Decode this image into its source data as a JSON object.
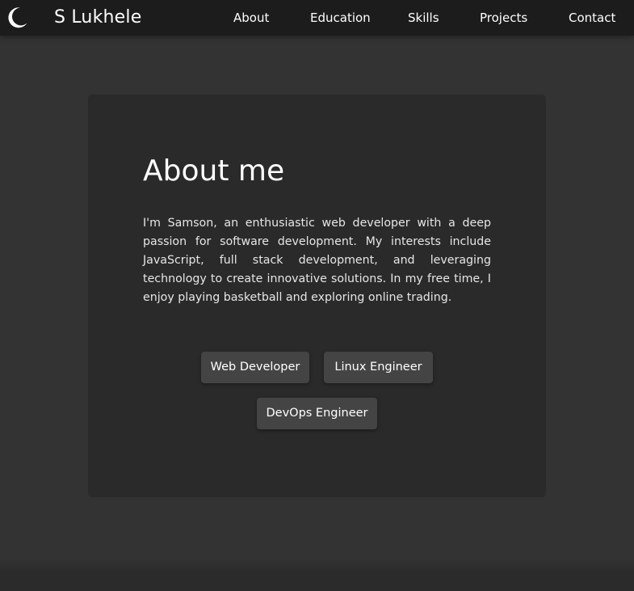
{
  "header": {
    "logo_icon": "crescent-moon-icon",
    "brand": "S Lukhele",
    "nav": [
      {
        "label": "About"
      },
      {
        "label": "Education"
      },
      {
        "label": "Skills"
      },
      {
        "label": "Projects"
      },
      {
        "label": "Contact"
      }
    ]
  },
  "about": {
    "title": "About me",
    "bio": "I'm Samson, an enthusiastic web developer with a deep passion for software development. My interests include JavaScript, full stack development, and leveraging technology to create innovative solutions. In my free time, I enjoy playing basketball and exploring online trading.",
    "roles": [
      {
        "label": "Web Developer"
      },
      {
        "label": "Linux Engineer"
      },
      {
        "label": "DevOps Engineer"
      }
    ]
  },
  "colors": {
    "page_background": "#333333",
    "navbar_background": "#1c1c1c",
    "card_background": "#2a2a2a",
    "tag_background": "#444444",
    "text": "#ffffff"
  }
}
